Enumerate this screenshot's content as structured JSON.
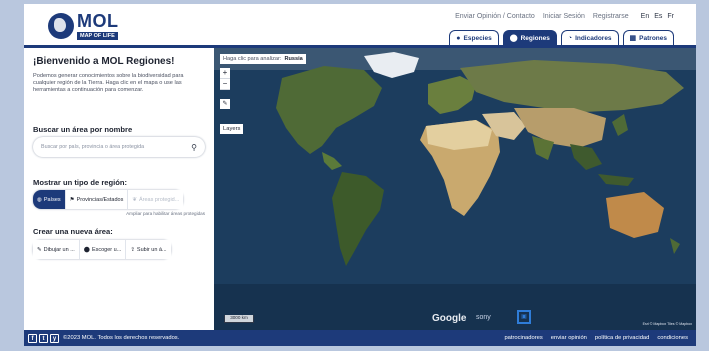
{
  "header": {
    "logo_text": "MOL",
    "logo_sub": "MAP OF LIFE",
    "top_links": [
      "Enviar Opinión / Contacto",
      "Iniciar Sesión",
      "Registrarse"
    ],
    "languages": [
      "En",
      "Es",
      "Fr"
    ],
    "tabs": [
      {
        "label": "Especies",
        "icon": "info-icon",
        "active": false
      },
      {
        "label": "Regiones",
        "icon": "pin-icon",
        "active": true
      },
      {
        "label": "Indicadores",
        "icon": "gauge-icon",
        "active": false
      },
      {
        "label": "Patrones",
        "icon": "grid-icon",
        "active": false
      }
    ]
  },
  "sidebar": {
    "title": "¡Bienvenido a MOL Regiones!",
    "intro": "Podemos generar conocimientos sobre la biodiversidad para cualquier región de la Tierra. Haga clic en el mapa o use las herramientas a continuación para comenzar.",
    "search_heading": "Buscar un área por nombre",
    "search_placeholder": "Buscar por país, provincia o área protegida",
    "region_type_heading": "Mostrar un tipo de región:",
    "region_types": [
      "Países",
      "Provincias/Estados",
      "Áreas protegid..."
    ],
    "helper_text": "Ampliar para habilitar áreas protegidas",
    "collapse_glyph": "«",
    "create_heading": "Crear una nueva área:",
    "create_buttons": [
      "Dibujar un ...",
      "Escoger u...",
      "Subir un á..."
    ]
  },
  "map": {
    "hint_label": "Haga clic para analizar:",
    "hint_value": "Russia",
    "zoom_in": "+",
    "zoom_out": "−",
    "layers_label": "Layers",
    "scale_label": "3000 km",
    "google_label": "Google",
    "sponsor_label": "sony",
    "attribution": "Esri © Mapbox Tiles © Mapbox",
    "colors": {
      "ocean": "#1c3d5e",
      "desert": "#d8c49a",
      "forest": "#3f5a2e",
      "ice": "#e9edf2"
    }
  },
  "footer": {
    "social": [
      "f",
      "t",
      "y"
    ],
    "copyright": "©2023 MOL. Todos los derechos reservados.",
    "links": [
      "patrocinadores",
      "enviar opinión",
      "política de privacidad",
      "condiciones"
    ]
  }
}
